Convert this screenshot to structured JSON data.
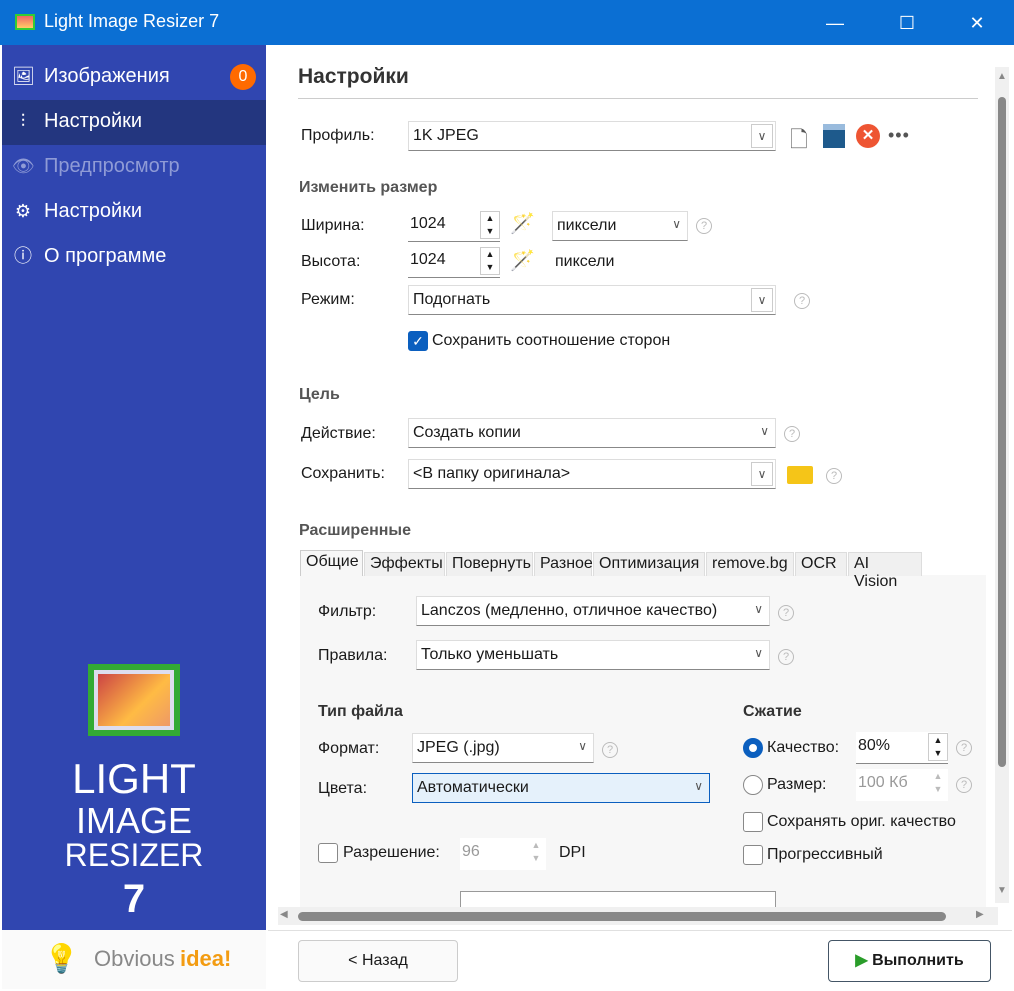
{
  "window": {
    "title": "Light Image Resizer 7",
    "minimize": "—",
    "maximize": "☐",
    "close": "✕"
  },
  "sidebar": {
    "items": [
      {
        "label": "Изображения",
        "icon": "images-icon",
        "badge": "0"
      },
      {
        "label": "Настройки",
        "icon": "sliders-icon"
      },
      {
        "label": "Предпросмотр",
        "icon": "eye-icon"
      },
      {
        "label": "Настройки",
        "icon": "gear-icon"
      },
      {
        "label": "О программе",
        "icon": "info-icon"
      }
    ],
    "logo": {
      "line1": "LIGHT",
      "line2": "IMAGE",
      "line3": "RESIZER",
      "line4": "7"
    },
    "brand": {
      "part1": "Obvious",
      "part2": "idea!"
    }
  },
  "main": {
    "title": "Настройки",
    "profile": {
      "label": "Профиль:",
      "value": "1K JPEG"
    },
    "resize": {
      "heading": "Изменить размер",
      "width_label": "Ширина:",
      "width": "1024",
      "unit": "пиксели",
      "height_label": "Высота:",
      "height": "1024",
      "height_unit": "пиксели",
      "mode_label": "Режим:",
      "mode": "Подогнать",
      "keep_ratio": "Сохранить соотношение сторон"
    },
    "target": {
      "heading": "Цель",
      "action_label": "Действие:",
      "action": "Создать копии",
      "save_label": "Сохранить:",
      "save": "<В папку оригинала>"
    },
    "advanced": {
      "heading": "Расширенные",
      "tabs": [
        "Общие",
        "Эффекты",
        "Повернуть",
        "Разное",
        "Оптимизация",
        "remove.bg",
        "OCR",
        "AI Vision"
      ],
      "filter_label": "Фильтр:",
      "filter": "Lanczos  (медленно, отличное качество)",
      "rules_label": "Правила:",
      "rules": "Только уменьшать",
      "filetype_heading": "Тип файла",
      "format_label": "Формат:",
      "format": "JPEG (.jpg)",
      "colors_label": "Цвета:",
      "colors": "Автоматически",
      "resolution_label": "Разрешение:",
      "resolution": "96",
      "dpi": "DPI",
      "compression_heading": "Сжатие",
      "quality_label": "Качество:",
      "quality": "80%",
      "size_label": "Размер:",
      "size": "100 Кб",
      "keep_quality": "Сохранять ориг. качество",
      "progressive": "Прогрессивный"
    }
  },
  "footer": {
    "back": "< Назад",
    "run": "Выполнить"
  },
  "colors": {
    "titlebar": "#0b6fd3",
    "sidebar": "#3046b0",
    "accent": "#0b5fbf",
    "badge": "#ff6a00"
  }
}
